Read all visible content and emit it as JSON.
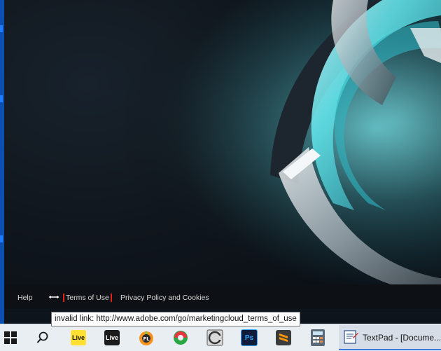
{
  "splash": {
    "footer": {
      "help_label": "Help",
      "terms_label": "Terms of Use",
      "privacy_label": "Privacy Policy and Cookies"
    }
  },
  "tooltip": {
    "text": "invalid link: http://www.adobe.com/go/marketingcloud_terms_of_use"
  },
  "taskbar": {
    "pinned": [
      {
        "name": "start",
        "icon": "windows-logo-icon"
      },
      {
        "name": "search",
        "icon": "search-icon"
      },
      {
        "name": "ableton-live-yellow",
        "label": "Live",
        "color": "#ffe033",
        "text_color": "#111111"
      },
      {
        "name": "ableton-live-dark",
        "label": "Live",
        "color": "#1b1b1b",
        "text_color": "#ffffff"
      },
      {
        "name": "fl-studio",
        "icon": "fl-studio-icon"
      },
      {
        "name": "reaper",
        "icon": "reaper-icon"
      },
      {
        "name": "adobe-app",
        "icon": "circle-c-icon"
      },
      {
        "name": "photoshop",
        "label": "Ps",
        "color": "#0f1c3a",
        "text_color": "#31a8ff"
      },
      {
        "name": "sublime-text",
        "icon": "sublime-icon",
        "color": "#ff9800"
      },
      {
        "name": "calculator",
        "icon": "calculator-icon"
      }
    ],
    "active_task": {
      "label": "TextPad - [Docume...",
      "icon": "textpad-icon"
    }
  },
  "colors": {
    "taskbar_bg": "#e9eef3",
    "footer_bg": "#0d1014",
    "accent_teal": "#5fe0e6",
    "terms_focus": "#e0241b",
    "active_underline": "#3b7bd8"
  }
}
